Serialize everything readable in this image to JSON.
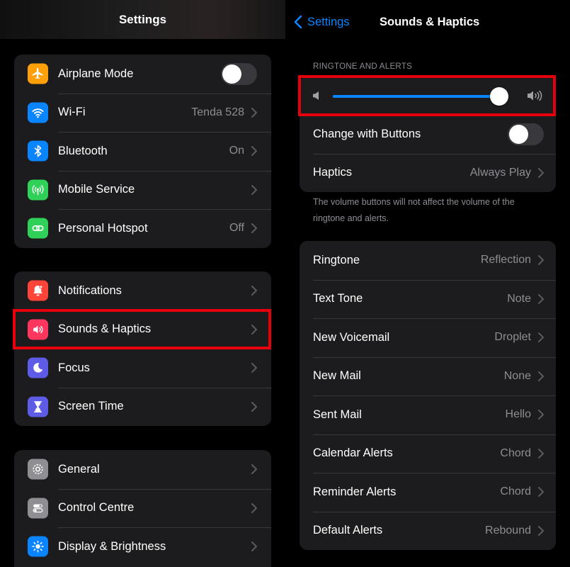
{
  "left": {
    "title": "Settings",
    "groups": [
      {
        "items": [
          {
            "label": "Airplane Mode",
            "icon": "airplane-icon",
            "color": "#ff9f0a",
            "control": "toggle",
            "toggle_on": false
          },
          {
            "label": "Wi-Fi",
            "value": "Tenda 528",
            "icon": "wifi-icon",
            "color": "#0a84ff"
          },
          {
            "label": "Bluetooth",
            "value": "On",
            "icon": "bluetooth-icon",
            "color": "#0a84ff"
          },
          {
            "label": "Mobile Service",
            "value": "",
            "icon": "antenna-icon",
            "color": "#30d158"
          },
          {
            "label": "Personal Hotspot",
            "value": "Off",
            "icon": "link-icon",
            "color": "#30d158"
          }
        ]
      },
      {
        "items": [
          {
            "label": "Notifications",
            "icon": "bell-icon",
            "color": "#ff453a"
          },
          {
            "label": "Sounds & Haptics",
            "icon": "speaker-icon",
            "color": "#ff375f",
            "highlighted": true
          },
          {
            "label": "Focus",
            "icon": "moon-icon",
            "color": "#5e5ce6"
          },
          {
            "label": "Screen Time",
            "icon": "hourglass-icon",
            "color": "#5e5ce6"
          }
        ]
      },
      {
        "items": [
          {
            "label": "General",
            "icon": "gear-icon",
            "color": "#8e8e93"
          },
          {
            "label": "Control Centre",
            "icon": "switches-icon",
            "color": "#8e8e93"
          },
          {
            "label": "Display & Brightness",
            "icon": "sun-icon",
            "color": "#0a84ff"
          }
        ]
      }
    ]
  },
  "right": {
    "back_label": "Settings",
    "title": "Sounds & Haptics",
    "section_header": "RINGTONE AND ALERTS",
    "volume_level": 0.95,
    "change_with_buttons": {
      "label": "Change with Buttons",
      "toggle_on": false
    },
    "haptics": {
      "label": "Haptics",
      "value": "Always Play"
    },
    "footer_note": "The volume buttons will not affect the volume of the ringtone and alerts.",
    "sounds": [
      {
        "label": "Ringtone",
        "value": "Reflection"
      },
      {
        "label": "Text Tone",
        "value": "Note"
      },
      {
        "label": "New Voicemail",
        "value": "Droplet"
      },
      {
        "label": "New Mail",
        "value": "None"
      },
      {
        "label": "Sent Mail",
        "value": "Hello"
      },
      {
        "label": "Calendar Alerts",
        "value": "Chord"
      },
      {
        "label": "Reminder Alerts",
        "value": "Chord"
      },
      {
        "label": "Default Alerts",
        "value": "Rebound"
      }
    ]
  },
  "colors": {
    "highlight": "#e5000b",
    "accent": "#0a84ff",
    "cell_background": "#1c1c1e",
    "secondary_text": "#8d8d93"
  }
}
